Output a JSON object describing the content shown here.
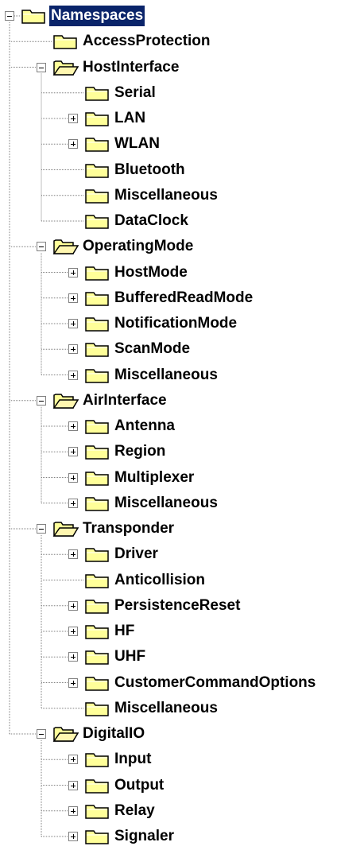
{
  "tree": {
    "root": {
      "label": "Namespaces",
      "expanded": true,
      "selected": true,
      "icon": "folder-icon",
      "children": [
        {
          "label": "AccessProtection"
        },
        {
          "label": "HostInterface",
          "expanded": true,
          "children": [
            {
              "label": "Serial"
            },
            {
              "label": "LAN",
              "collapsed": true
            },
            {
              "label": "WLAN",
              "collapsed": true
            },
            {
              "label": "Bluetooth"
            },
            {
              "label": "Miscellaneous"
            },
            {
              "label": "DataClock"
            }
          ]
        },
        {
          "label": "OperatingMode",
          "expanded": true,
          "children": [
            {
              "label": "HostMode",
              "collapsed": true
            },
            {
              "label": "BufferedReadMode",
              "collapsed": true
            },
            {
              "label": "NotificationMode",
              "collapsed": true
            },
            {
              "label": "ScanMode",
              "collapsed": true
            },
            {
              "label": "Miscellaneous",
              "collapsed": true
            }
          ]
        },
        {
          "label": "AirInterface",
          "expanded": true,
          "children": [
            {
              "label": "Antenna",
              "collapsed": true
            },
            {
              "label": "Region",
              "collapsed": true
            },
            {
              "label": "Multiplexer",
              "collapsed": true
            },
            {
              "label": "Miscellaneous",
              "collapsed": true
            }
          ]
        },
        {
          "label": "Transponder",
          "expanded": true,
          "children": [
            {
              "label": "Driver",
              "collapsed": true
            },
            {
              "label": "Anticollision"
            },
            {
              "label": "PersistenceReset",
              "collapsed": true
            },
            {
              "label": "HF",
              "collapsed": true
            },
            {
              "label": "UHF",
              "collapsed": true
            },
            {
              "label": "CustomerCommandOptions",
              "collapsed": true
            },
            {
              "label": "Miscellaneous"
            }
          ]
        },
        {
          "label": "DigitalIO",
          "expanded": true,
          "children": [
            {
              "label": "Input",
              "collapsed": true
            },
            {
              "label": "Output",
              "collapsed": true
            },
            {
              "label": "Relay",
              "collapsed": true
            },
            {
              "label": "Signaler",
              "collapsed": true
            }
          ]
        }
      ]
    }
  },
  "colors": {
    "selection_bg": "#0a246a",
    "selection_text": "#ffffff",
    "folder_fill": "#ffff99",
    "folder_outline": "#000000",
    "connector_line": "#808080"
  }
}
